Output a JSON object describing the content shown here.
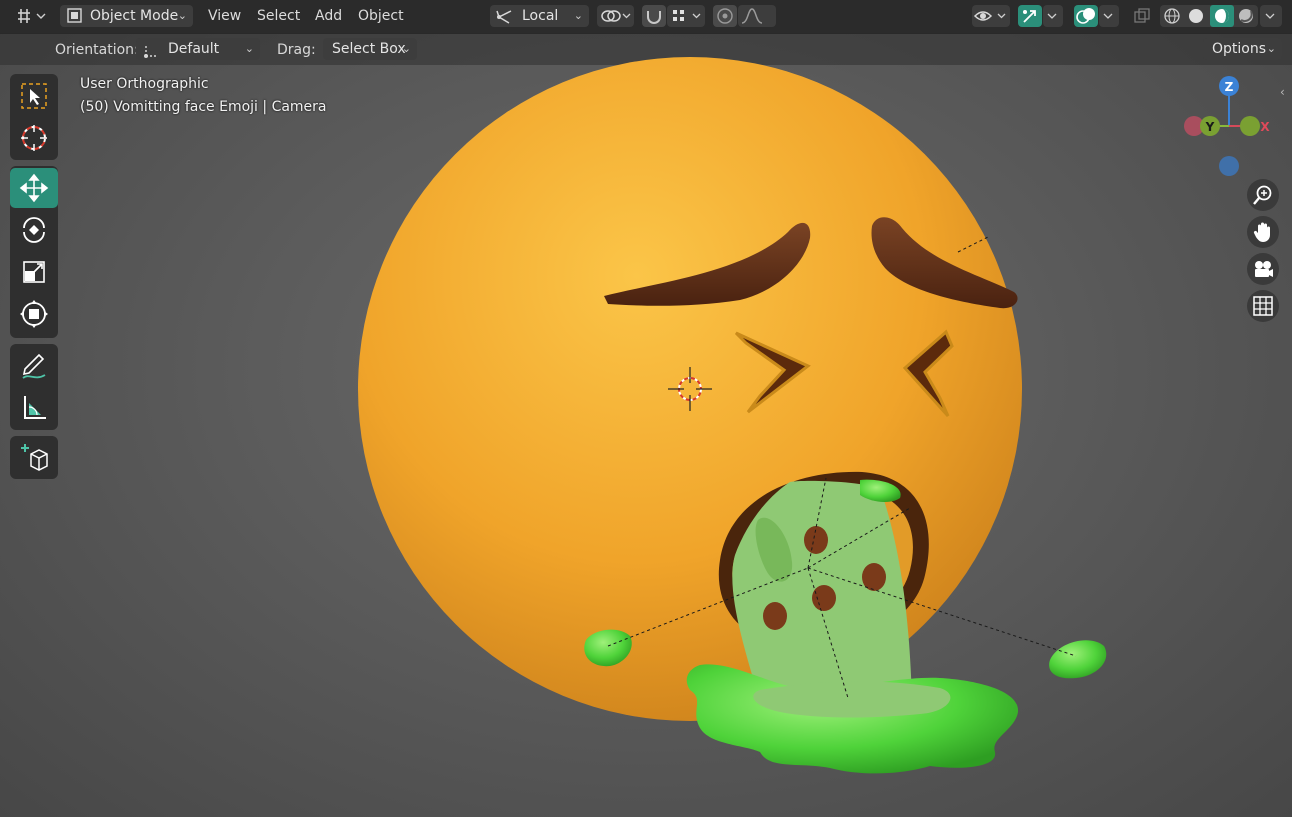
{
  "header": {
    "editor_type_icon": "editor-type-3d-viewport-icon",
    "mode_label": "Object Mode",
    "menus": [
      "View",
      "Select",
      "Add",
      "Object"
    ],
    "transform_orientation_label": "Local",
    "pivot_icon": "pivot-point-icon",
    "snap_icon": "magnet-icon",
    "proportional_icon": "proportional-edit-icon",
    "visibility_icon": "eye-icon",
    "gizmo_icon": "gizmo-icon",
    "overlay_icon": "overlay-icon",
    "xray_icon": "xray-icon",
    "shading_modes": [
      "wireframe",
      "solid",
      "material-preview",
      "rendered"
    ],
    "active_shading": "material-preview"
  },
  "toolbar_settings": {
    "orientation_label": "Orientation:",
    "orientation_value": "Default",
    "drag_label": "Drag:",
    "drag_value": "Select Box",
    "options_label": "Options"
  },
  "viewport": {
    "view_name": "User Orthographic",
    "object_info": "(50) Vomitting face Emoji | Camera"
  },
  "tools": [
    {
      "name": "select-box",
      "icon": "select-box-icon",
      "active": false
    },
    {
      "name": "cursor",
      "icon": "cursor-icon",
      "active": false
    },
    {
      "name": "move",
      "icon": "move-icon",
      "active": true
    },
    {
      "name": "rotate",
      "icon": "rotate-icon",
      "active": false
    },
    {
      "name": "scale",
      "icon": "scale-icon",
      "active": false
    },
    {
      "name": "transform",
      "icon": "transform-icon",
      "active": false
    },
    {
      "name": "annotate",
      "icon": "annotate-icon",
      "active": false
    },
    {
      "name": "measure",
      "icon": "measure-icon",
      "active": false
    },
    {
      "name": "add-cube",
      "icon": "add-cube-icon",
      "active": false
    }
  ],
  "nav_gizmo": {
    "axes": {
      "x": "X",
      "y": "Y",
      "z": "Z"
    },
    "colors": {
      "x": "#d64a5a",
      "y": "#8ab83a",
      "z": "#3b82d6"
    }
  },
  "nav_buttons": [
    "zoom-icon",
    "pan-hand-icon",
    "camera-view-icon",
    "grid-perspective-icon"
  ],
  "colors": {
    "accent": "#2b8f7a",
    "face_yellow": "#f0a52a",
    "brow_brown": "#5a2a14",
    "vomit_green": "#4fd33a"
  }
}
